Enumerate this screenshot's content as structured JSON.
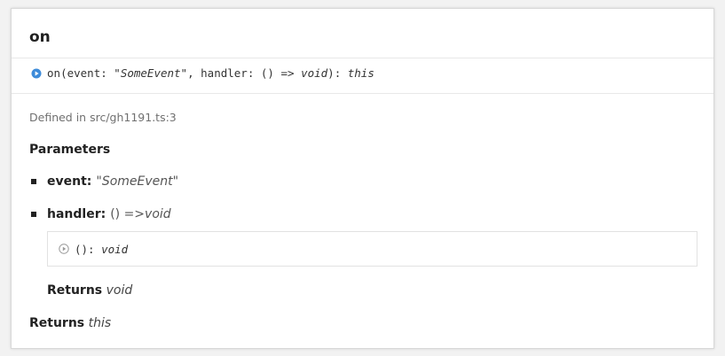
{
  "member": {
    "title": "on",
    "signature": {
      "name": "on",
      "open_paren": "(",
      "param1_name": "event",
      "colon_sep": ": ",
      "param1_type": "\"SomeEvent\"",
      "comma": ", ",
      "param2_name": "handler",
      "param2_type_prefix": "() => ",
      "param2_type_void": "void",
      "close": "): ",
      "return_type": "this",
      "icon": "method-circle-icon"
    },
    "defined_in": "Defined in src/gh1191.ts:3",
    "parameters_heading": "Parameters",
    "parameters": [
      {
        "name": "event:",
        "type_italic": "\"SomeEvent\"",
        "type_prefix": ""
      },
      {
        "name": "handler:",
        "type_prefix": "() => ",
        "type_italic": "void"
      }
    ],
    "nested_signature": {
      "text": "(): ",
      "return_type": "void",
      "icon": "play-circle-icon"
    },
    "nested_returns": {
      "label": "Returns",
      "type": "void"
    },
    "returns": {
      "label": "Returns",
      "type": "this"
    }
  },
  "colors": {
    "accent": "#3d8bd9",
    "muted_icon": "#9a9a9a",
    "text": "#222222",
    "muted_text": "#707070"
  }
}
